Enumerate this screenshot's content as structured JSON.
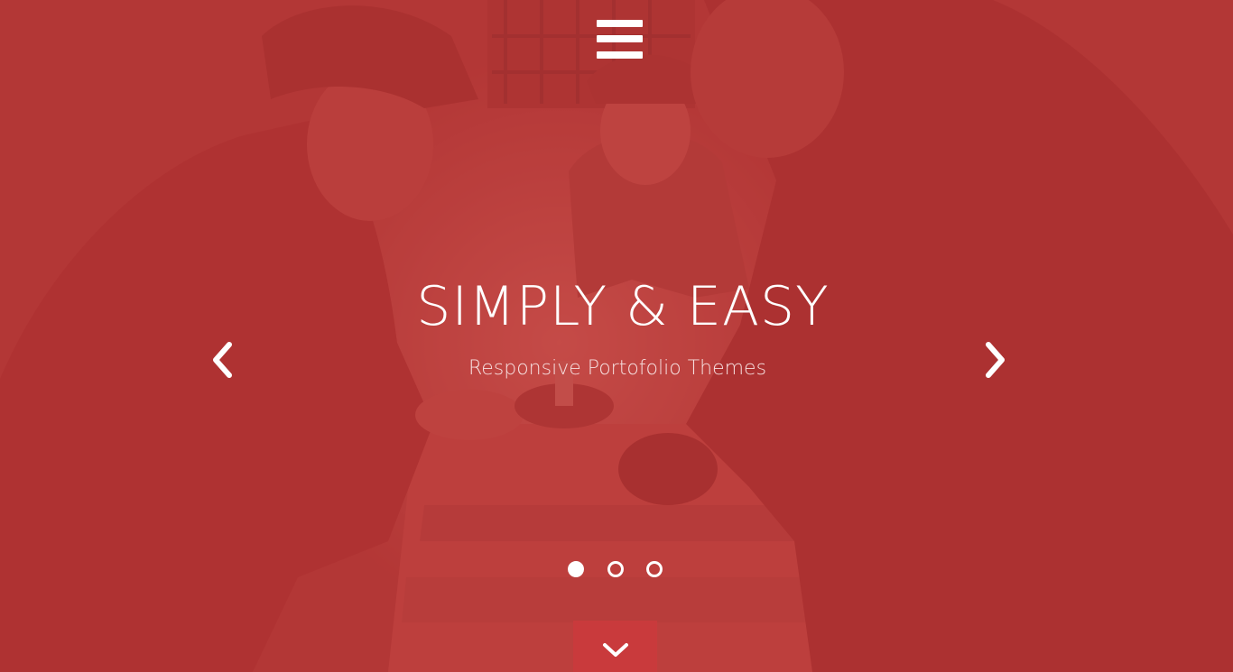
{
  "hero": {
    "title": "SIMPLY & EASY",
    "subtitle": "Responsive Portofolio Themes",
    "overlay_color": "#b53434",
    "accent_color": "#c93a3c",
    "text_color": "#ffffff"
  },
  "icons": {
    "menu": "hamburger-menu-icon",
    "prev": "chevron-left-icon",
    "next": "chevron-right-icon",
    "scroll": "chevron-down-icon"
  },
  "carousel": {
    "slide_count": 3,
    "active_index": 0
  }
}
